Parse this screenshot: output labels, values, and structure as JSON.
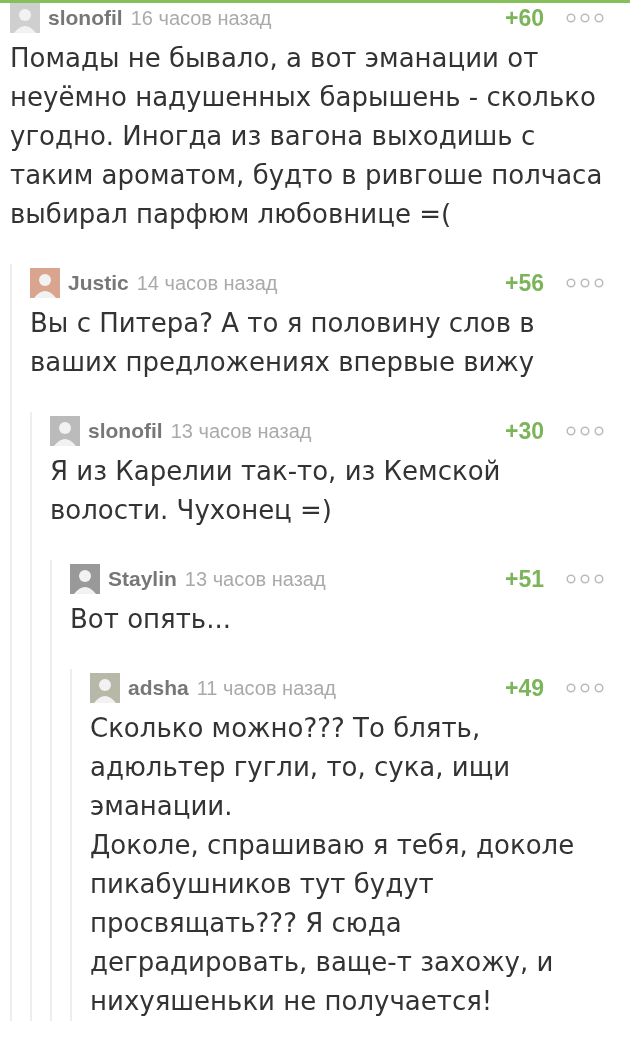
{
  "comments": [
    {
      "author": "slonofil",
      "time": "16 часов назад",
      "rating": "+60",
      "text": "Помады не бывало, а вот эманации от неуёмно надушенных барышень - сколько угодно. Иногда из вагона выходишь с таким ароматом, будто в ривгоше полчаса выбирал парфюм любовнице =(",
      "children": [
        {
          "author": "Justic",
          "time": "14 часов назад",
          "rating": "+56",
          "text": "Вы с Питера? А то я половину слов в ваших предложениях впервые вижу",
          "children": [
            {
              "author": "slonofil",
              "time": "13 часов назад",
              "rating": "+30",
              "text": "Я из Карелии так-то, из Кемской волости. Чухонец =)",
              "children": [
                {
                  "author": "Staylin",
                  "time": "13 часов назад",
                  "rating": "+51",
                  "text": "Вот опять...",
                  "children": [
                    {
                      "author": "adsha",
                      "time": "11 часов назад",
                      "rating": "+49",
                      "text": "Сколько можно??? То блять, адюльтер гугли, то, сука, ищи эманации.\nДоколе, спрашиваю я тебя, доколе пикабушников тут будут просвящать??? Я сюда деградировать, ваще-т захожу, и нихуяшеньки не получается!"
                    }
                  ]
                }
              ]
            }
          ]
        }
      ]
    }
  ]
}
